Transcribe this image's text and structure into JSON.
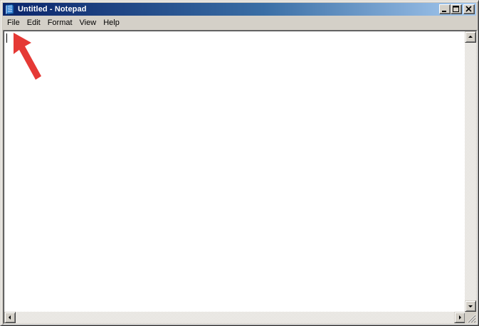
{
  "window": {
    "title": "Untitled - Notepad",
    "icon": "notepad-icon",
    "controls": [
      "minimize-icon",
      "maximize-icon",
      "close-icon"
    ]
  },
  "menu": {
    "items": [
      "File",
      "Edit",
      "Format",
      "View",
      "Help"
    ]
  },
  "editor": {
    "content": ""
  },
  "annotation": {
    "type": "arrow",
    "target": "File",
    "color": "#e53935"
  },
  "colors": {
    "titlebar_start": "#0a246a",
    "titlebar_end": "#a6caf0",
    "chrome": "#d4d0c8"
  }
}
